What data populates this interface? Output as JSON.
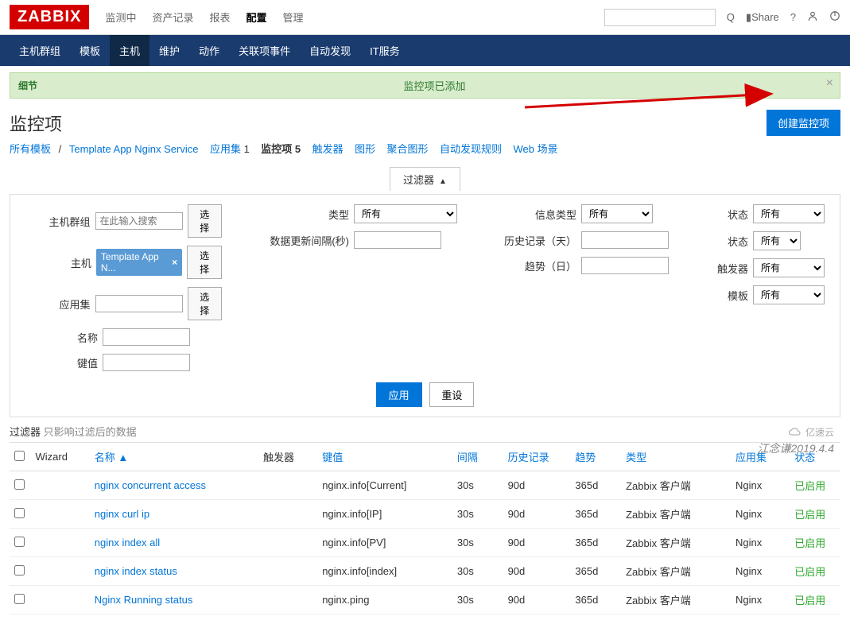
{
  "brand": "ZABBIX",
  "top_nav": [
    "监测中",
    "资产记录",
    "报表",
    "配置",
    "管理"
  ],
  "top_nav_active": 3,
  "search_placeholder": "",
  "share_label": "Share",
  "sub_nav": [
    "主机群组",
    "模板",
    "主机",
    "维护",
    "动作",
    "关联项事件",
    "自动发现",
    "IT服务"
  ],
  "sub_nav_active": 2,
  "notice": {
    "detail": "细节",
    "message": "监控项已添加"
  },
  "page_title": "监控项",
  "create_btn": "创建监控项",
  "breadcrumb": {
    "all_templates": "所有模板",
    "template_name": "Template App Nginx Service",
    "items": [
      {
        "label": "应用集",
        "count": "1",
        "link": true
      },
      {
        "label": "监控项",
        "count": "5",
        "current": true
      },
      {
        "label": "触发器",
        "count": "",
        "link": true
      },
      {
        "label": "图形",
        "count": "",
        "link": true
      },
      {
        "label": "聚合图形",
        "count": "",
        "link": true
      },
      {
        "label": "自动发现规则",
        "count": "",
        "link": true
      },
      {
        "label": "Web 场景",
        "count": "",
        "link": true
      }
    ]
  },
  "filter_toggle": "过滤器",
  "filter": {
    "labels": {
      "hostgroup": "主机群组",
      "host": "主机",
      "application": "应用集",
      "name": "名称",
      "key": "键值",
      "type": "类型",
      "update_interval": "数据更新间隔(秒)",
      "info_type": "信息类型",
      "history": "历史记录（天）",
      "trends": "趋势（日）",
      "status": "状态",
      "state": "状态",
      "triggers": "触发器",
      "template": "模板"
    },
    "host_tag": "Template App N...",
    "hostgroup_placeholder": "在此输入搜索",
    "select_btn": "选择",
    "all_option": "所有",
    "apply": "应用",
    "reset": "重设"
  },
  "filter_note_prefix": "过滤器",
  "filter_note_gray": "只影响过滤后的数据",
  "columns": {
    "wizard": "Wizard",
    "name": "名称",
    "triggers": "触发器",
    "key": "键值",
    "interval": "间隔",
    "history": "历史记录",
    "trends": "趋势",
    "type": "类型",
    "application": "应用集",
    "status": "状态"
  },
  "sort_indicator": "▲",
  "rows": [
    {
      "name": "nginx concurrent access",
      "key": "nginx.info[Current]",
      "interval": "30s",
      "history": "90d",
      "trends": "365d",
      "type": "Zabbix 客户端",
      "application": "Nginx",
      "status": "已启用"
    },
    {
      "name": "nginx curl ip",
      "key": "nginx.info[IP]",
      "interval": "30s",
      "history": "90d",
      "trends": "365d",
      "type": "Zabbix 客户端",
      "application": "Nginx",
      "status": "已启用"
    },
    {
      "name": "nginx index all",
      "key": "nginx.info[PV]",
      "interval": "30s",
      "history": "90d",
      "trends": "365d",
      "type": "Zabbix 客户端",
      "application": "Nginx",
      "status": "已启用"
    },
    {
      "name": "nginx index status",
      "key": "nginx.info[index]",
      "interval": "30s",
      "history": "90d",
      "trends": "365d",
      "type": "Zabbix 客户端",
      "application": "Nginx",
      "status": "已启用"
    },
    {
      "name": "Nginx Running status",
      "key": "nginx.ping",
      "interval": "30s",
      "history": "90d",
      "trends": "365d",
      "type": "Zabbix 客户端",
      "application": "Nginx",
      "status": "已启用"
    }
  ],
  "watermark": "江念谦2019.4.4",
  "cloud_badge": "亿速云"
}
